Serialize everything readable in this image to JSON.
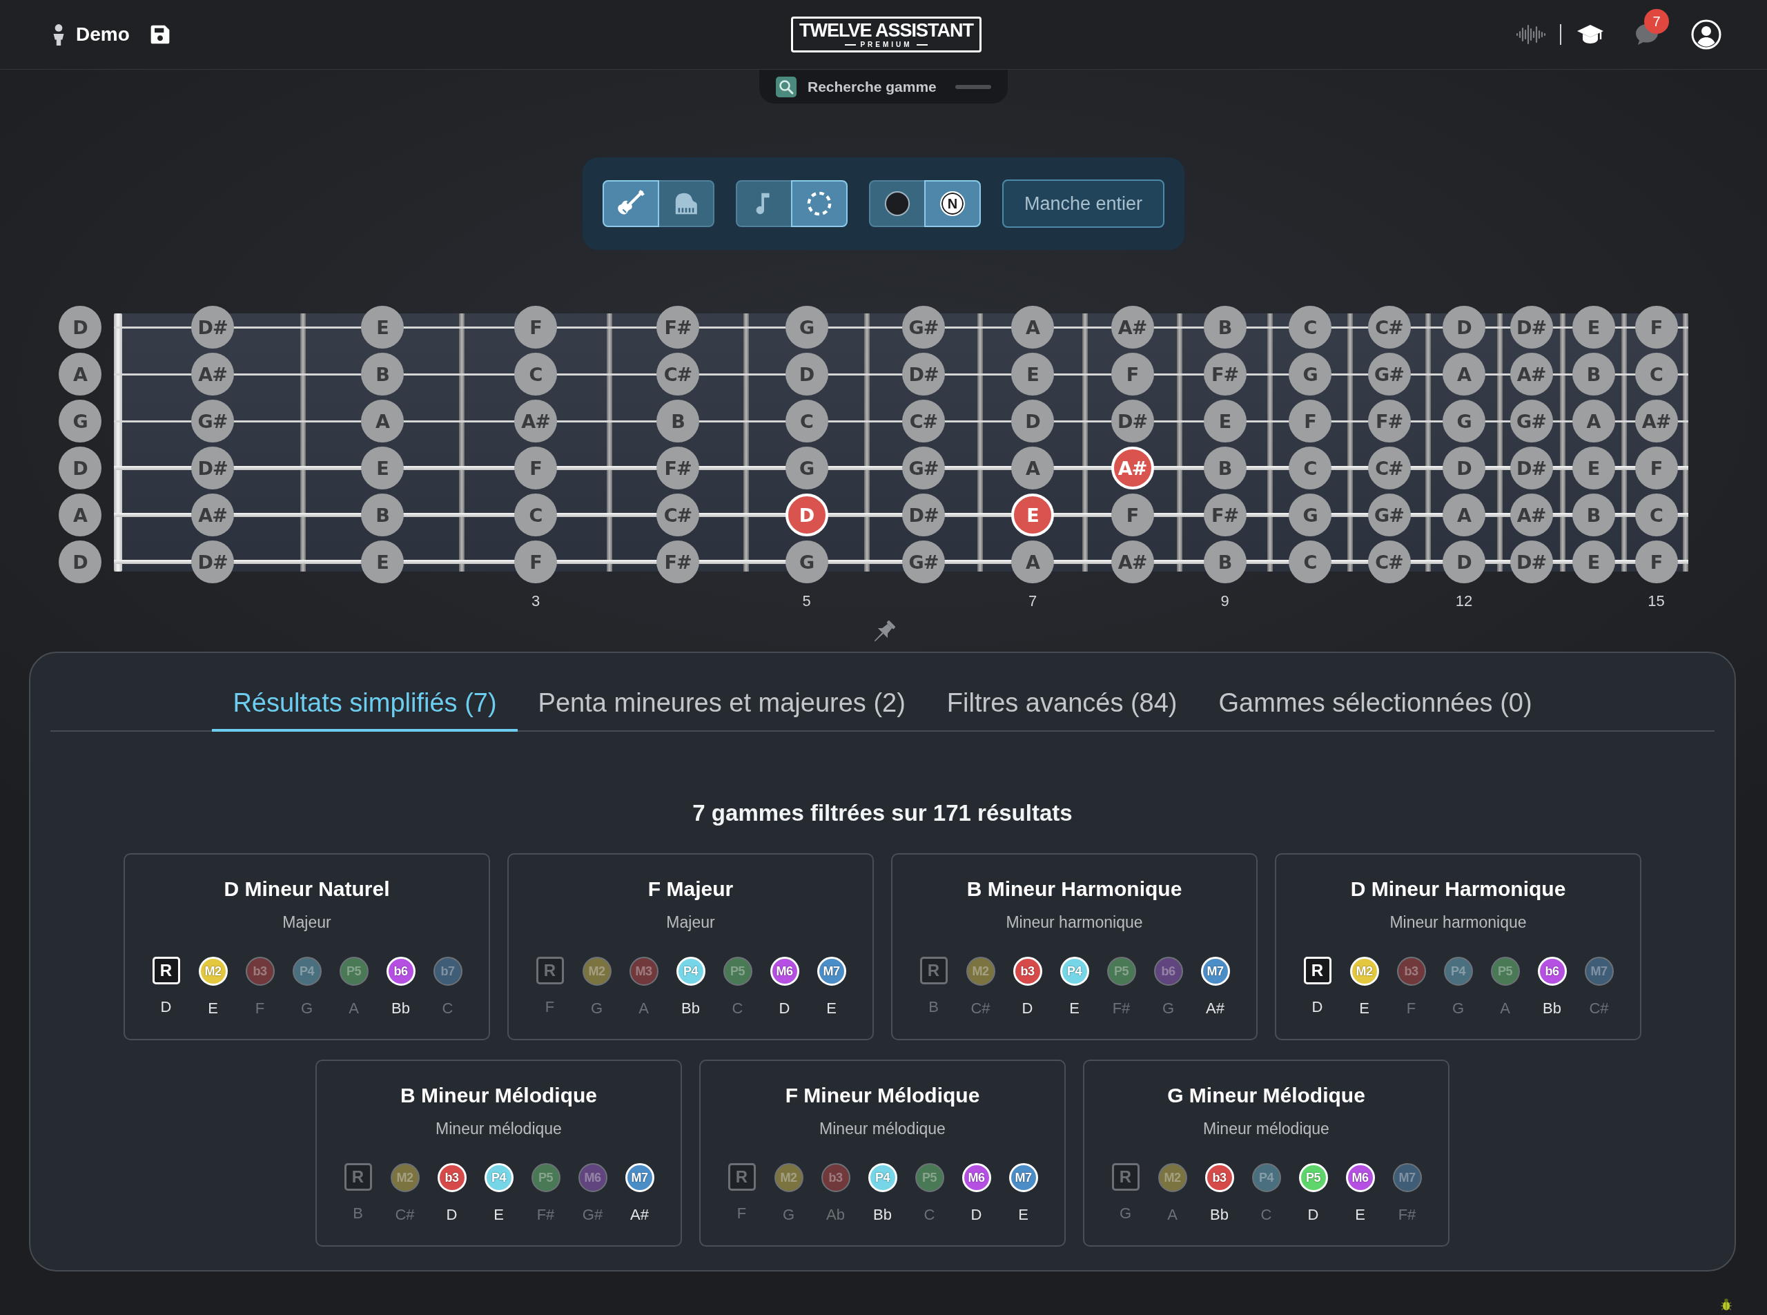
{
  "top_bar": {
    "user": "Demo",
    "logo": {
      "title": "TWELVE ASSISTANT",
      "subtitle": "PREMIUM"
    },
    "notification_count": "7"
  },
  "scale_search_tab": {
    "label": "Recherche gamme"
  },
  "toolbar": {
    "groups": [
      {
        "buttons": [
          {
            "kind": "guitar",
            "selected": true
          },
          {
            "kind": "piano",
            "selected": false
          }
        ]
      },
      {
        "buttons": [
          {
            "kind": "note",
            "selected": false
          },
          {
            "kind": "circle-dashed",
            "selected": true
          }
        ]
      },
      {
        "buttons": [
          {
            "kind": "dot",
            "selected": false
          },
          {
            "kind": "letter",
            "text": "N",
            "selected": true
          }
        ]
      }
    ],
    "range_button": "Manche entier"
  },
  "fretboard": {
    "strings": [
      {
        "open": "D",
        "notes": [
          {
            "note": "D#",
            "highlighted": false
          },
          {
            "note": "E",
            "highlighted": false
          },
          {
            "note": "F",
            "highlighted": false
          },
          {
            "note": "F#",
            "highlighted": false
          },
          {
            "note": "G",
            "highlighted": false
          },
          {
            "note": "G#",
            "highlighted": false
          },
          {
            "note": "A",
            "highlighted": false
          },
          {
            "note": "A#",
            "highlighted": false
          },
          {
            "note": "B",
            "highlighted": false
          },
          {
            "note": "C",
            "highlighted": false
          },
          {
            "note": "C#",
            "highlighted": false
          },
          {
            "note": "D",
            "highlighted": false
          },
          {
            "note": "D#",
            "highlighted": false
          },
          {
            "note": "E",
            "highlighted": false
          },
          {
            "note": "F",
            "highlighted": false
          }
        ]
      },
      {
        "open": "A",
        "notes": [
          {
            "note": "A#",
            "highlighted": false
          },
          {
            "note": "B",
            "highlighted": false
          },
          {
            "note": "C",
            "highlighted": false
          },
          {
            "note": "C#",
            "highlighted": false
          },
          {
            "note": "D",
            "highlighted": false
          },
          {
            "note": "D#",
            "highlighted": false
          },
          {
            "note": "E",
            "highlighted": false
          },
          {
            "note": "F",
            "highlighted": false
          },
          {
            "note": "F#",
            "highlighted": false
          },
          {
            "note": "G",
            "highlighted": false
          },
          {
            "note": "G#",
            "highlighted": false
          },
          {
            "note": "A",
            "highlighted": false
          },
          {
            "note": "A#",
            "highlighted": false
          },
          {
            "note": "B",
            "highlighted": false
          },
          {
            "note": "C",
            "highlighted": false
          }
        ]
      },
      {
        "open": "G",
        "notes": [
          {
            "note": "G#",
            "highlighted": false
          },
          {
            "note": "A",
            "highlighted": false
          },
          {
            "note": "A#",
            "highlighted": false
          },
          {
            "note": "B",
            "highlighted": false
          },
          {
            "note": "C",
            "highlighted": false
          },
          {
            "note": "C#",
            "highlighted": false
          },
          {
            "note": "D",
            "highlighted": false
          },
          {
            "note": "D#",
            "highlighted": false
          },
          {
            "note": "E",
            "highlighted": false
          },
          {
            "note": "F",
            "highlighted": false
          },
          {
            "note": "F#",
            "highlighted": false
          },
          {
            "note": "G",
            "highlighted": false
          },
          {
            "note": "G#",
            "highlighted": false
          },
          {
            "note": "A",
            "highlighted": false
          },
          {
            "note": "A#",
            "highlighted": false
          }
        ]
      },
      {
        "open": "D",
        "notes": [
          {
            "note": "D#",
            "highlighted": false
          },
          {
            "note": "E",
            "highlighted": false
          },
          {
            "note": "F",
            "highlighted": false
          },
          {
            "note": "F#",
            "highlighted": false
          },
          {
            "note": "G",
            "highlighted": false
          },
          {
            "note": "G#",
            "highlighted": false
          },
          {
            "note": "A",
            "highlighted": false
          },
          {
            "note": "A#",
            "highlighted": true
          },
          {
            "note": "B",
            "highlighted": false
          },
          {
            "note": "C",
            "highlighted": false
          },
          {
            "note": "C#",
            "highlighted": false
          },
          {
            "note": "D",
            "highlighted": false
          },
          {
            "note": "D#",
            "highlighted": false
          },
          {
            "note": "E",
            "highlighted": false
          },
          {
            "note": "F",
            "highlighted": false
          }
        ]
      },
      {
        "open": "A",
        "notes": [
          {
            "note": "A#",
            "highlighted": false
          },
          {
            "note": "B",
            "highlighted": false
          },
          {
            "note": "C",
            "highlighted": false
          },
          {
            "note": "C#",
            "highlighted": false
          },
          {
            "note": "D",
            "highlighted": true
          },
          {
            "note": "D#",
            "highlighted": false
          },
          {
            "note": "E",
            "highlighted": true
          },
          {
            "note": "F",
            "highlighted": false
          },
          {
            "note": "F#",
            "highlighted": false
          },
          {
            "note": "G",
            "highlighted": false
          },
          {
            "note": "G#",
            "highlighted": false
          },
          {
            "note": "A",
            "highlighted": false
          },
          {
            "note": "A#",
            "highlighted": false
          },
          {
            "note": "B",
            "highlighted": false
          },
          {
            "note": "C",
            "highlighted": false
          }
        ]
      },
      {
        "open": "D",
        "notes": [
          {
            "note": "D#",
            "highlighted": false
          },
          {
            "note": "E",
            "highlighted": false
          },
          {
            "note": "F",
            "highlighted": false
          },
          {
            "note": "F#",
            "highlighted": false
          },
          {
            "note": "G",
            "highlighted": false
          },
          {
            "note": "G#",
            "highlighted": false
          },
          {
            "note": "A",
            "highlighted": false
          },
          {
            "note": "A#",
            "highlighted": false
          },
          {
            "note": "B",
            "highlighted": false
          },
          {
            "note": "C",
            "highlighted": false
          },
          {
            "note": "C#",
            "highlighted": false
          },
          {
            "note": "D",
            "highlighted": false
          },
          {
            "note": "D#",
            "highlighted": false
          },
          {
            "note": "E",
            "highlighted": false
          },
          {
            "note": "F",
            "highlighted": false
          }
        ]
      }
    ],
    "frets": [
      {
        "marked": false
      },
      {
        "marked": false
      },
      {
        "marked": true,
        "number": "3"
      },
      {
        "marked": false
      },
      {
        "marked": true,
        "number": "5"
      },
      {
        "marked": false
      },
      {
        "marked": true,
        "number": "7"
      },
      {
        "marked": false
      },
      {
        "marked": true,
        "number": "9"
      },
      {
        "marked": false
      },
      {
        "marked": false
      },
      {
        "marked": true,
        "number": "12"
      },
      {
        "marked": false
      },
      {
        "marked": false
      },
      {
        "marked": true,
        "number": "15"
      }
    ]
  },
  "results": {
    "tabs": [
      {
        "label": "Résultats simplifiés (7)",
        "selected": true
      },
      {
        "label": "Penta mineures et majeures (2)",
        "selected": false
      },
      {
        "label": "Filtres avancés (84)",
        "selected": false
      },
      {
        "label": "Gammes sélectionnées (0)",
        "selected": false
      }
    ],
    "summary": "7 gammes filtrées sur 171 résultats",
    "scales": [
      {
        "name": "D Mineur Naturel",
        "mode": "Majeur",
        "degrees": [
          {
            "kind": "root",
            "label": "R",
            "note": "D",
            "active": true
          },
          {
            "kind": "degree",
            "label": "M2",
            "note": "E",
            "active": true,
            "color": "#e3c73f"
          },
          {
            "kind": "degree",
            "label": "b3",
            "note": "F",
            "active": false,
            "color": "#72393d"
          },
          {
            "kind": "degree",
            "label": "P4",
            "note": "G",
            "active": false,
            "color": "#4a7080"
          },
          {
            "kind": "degree",
            "label": "P5",
            "note": "A",
            "active": false,
            "color": "#4a7a55"
          },
          {
            "kind": "degree",
            "label": "b6",
            "note": "Bb",
            "active": true,
            "color": "#b550e2"
          },
          {
            "kind": "degree",
            "label": "b7",
            "note": "C",
            "active": false,
            "color": "#405d78"
          }
        ]
      },
      {
        "name": "F Majeur",
        "mode": "Majeur",
        "degrees": [
          {
            "kind": "root",
            "label": "R",
            "note": "F",
            "active": false
          },
          {
            "kind": "degree",
            "label": "M2",
            "note": "G",
            "active": false,
            "color": "#7b7340"
          },
          {
            "kind": "degree",
            "label": "M3",
            "note": "A",
            "active": false,
            "color": "#72393d"
          },
          {
            "kind": "degree",
            "label": "P4",
            "note": "Bb",
            "active": true,
            "color": "#76d5e6"
          },
          {
            "kind": "degree",
            "label": "P5",
            "note": "C",
            "active": false,
            "color": "#4a7a55"
          },
          {
            "kind": "degree",
            "label": "M6",
            "note": "D",
            "active": true,
            "color": "#b550e2"
          },
          {
            "kind": "degree",
            "label": "M7",
            "note": "E",
            "active": true,
            "color": "#4b8dc6"
          }
        ]
      },
      {
        "name": "B Mineur Harmonique",
        "mode": "Mineur harmonique",
        "degrees": [
          {
            "kind": "root",
            "label": "R",
            "note": "B",
            "active": false
          },
          {
            "kind": "degree",
            "label": "M2",
            "note": "C#",
            "active": false,
            "color": "#7b7340"
          },
          {
            "kind": "degree",
            "label": "b3",
            "note": "D",
            "active": true,
            "color": "#d64a4a"
          },
          {
            "kind": "degree",
            "label": "P4",
            "note": "E",
            "active": true,
            "color": "#76d5e6"
          },
          {
            "kind": "degree",
            "label": "P5",
            "note": "F#",
            "active": false,
            "color": "#4a7a55"
          },
          {
            "kind": "degree",
            "label": "b6",
            "note": "G",
            "active": false,
            "color": "#61457f"
          },
          {
            "kind": "degree",
            "label": "M7",
            "note": "A#",
            "active": true,
            "color": "#4b8dc6"
          }
        ]
      },
      {
        "name": "D Mineur Harmonique",
        "mode": "Mineur harmonique",
        "degrees": [
          {
            "kind": "root",
            "label": "R",
            "note": "D",
            "active": true
          },
          {
            "kind": "degree",
            "label": "M2",
            "note": "E",
            "active": true,
            "color": "#e3c73f"
          },
          {
            "kind": "degree",
            "label": "b3",
            "note": "F",
            "active": false,
            "color": "#72393d"
          },
          {
            "kind": "degree",
            "label": "P4",
            "note": "G",
            "active": false,
            "color": "#4a7080"
          },
          {
            "kind": "degree",
            "label": "P5",
            "note": "A",
            "active": false,
            "color": "#4a7a55"
          },
          {
            "kind": "degree",
            "label": "b6",
            "note": "Bb",
            "active": true,
            "color": "#b550e2"
          },
          {
            "kind": "degree",
            "label": "M7",
            "note": "C#",
            "active": false,
            "color": "#405d78"
          }
        ]
      },
      {
        "name": "B Mineur Mélodique",
        "mode": "Mineur mélodique",
        "degrees": [
          {
            "kind": "root",
            "label": "R",
            "note": "B",
            "active": false
          },
          {
            "kind": "degree",
            "label": "M2",
            "note": "C#",
            "active": false,
            "color": "#7b7340"
          },
          {
            "kind": "degree",
            "label": "b3",
            "note": "D",
            "active": true,
            "color": "#d64a4a"
          },
          {
            "kind": "degree",
            "label": "P4",
            "note": "E",
            "active": true,
            "color": "#76d5e6"
          },
          {
            "kind": "degree",
            "label": "P5",
            "note": "F#",
            "active": false,
            "color": "#4a7a55"
          },
          {
            "kind": "degree",
            "label": "M6",
            "note": "G#",
            "active": false,
            "color": "#61457f"
          },
          {
            "kind": "degree",
            "label": "M7",
            "note": "A#",
            "active": true,
            "color": "#4b8dc6"
          }
        ]
      },
      {
        "name": "F Mineur Mélodique",
        "mode": "Mineur mélodique",
        "degrees": [
          {
            "kind": "root",
            "label": "R",
            "note": "F",
            "active": false
          },
          {
            "kind": "degree",
            "label": "M2",
            "note": "G",
            "active": false,
            "color": "#7b7340"
          },
          {
            "kind": "degree",
            "label": "b3",
            "note": "Ab",
            "active": false,
            "color": "#72393d"
          },
          {
            "kind": "degree",
            "label": "P4",
            "note": "Bb",
            "active": true,
            "color": "#76d5e6"
          },
          {
            "kind": "degree",
            "label": "P5",
            "note": "C",
            "active": false,
            "color": "#4a7a55"
          },
          {
            "kind": "degree",
            "label": "M6",
            "note": "D",
            "active": true,
            "color": "#b550e2"
          },
          {
            "kind": "degree",
            "label": "M7",
            "note": "E",
            "active": true,
            "color": "#4b8dc6"
          }
        ]
      },
      {
        "name": "G Mineur Mélodique",
        "mode": "Mineur mélodique",
        "degrees": [
          {
            "kind": "root",
            "label": "R",
            "note": "G",
            "active": false
          },
          {
            "kind": "degree",
            "label": "M2",
            "note": "A",
            "active": false,
            "color": "#7b7340"
          },
          {
            "kind": "degree",
            "label": "b3",
            "note": "Bb",
            "active": true,
            "color": "#d64a4a"
          },
          {
            "kind": "degree",
            "label": "P4",
            "note": "C",
            "active": false,
            "color": "#4a7080"
          },
          {
            "kind": "degree",
            "label": "P5",
            "note": "D",
            "active": true,
            "color": "#5fd66b"
          },
          {
            "kind": "degree",
            "label": "M6",
            "note": "E",
            "active": true,
            "color": "#b550e2"
          },
          {
            "kind": "degree",
            "label": "M7",
            "note": "F#",
            "active": false,
            "color": "#405d78"
          }
        ]
      }
    ]
  }
}
